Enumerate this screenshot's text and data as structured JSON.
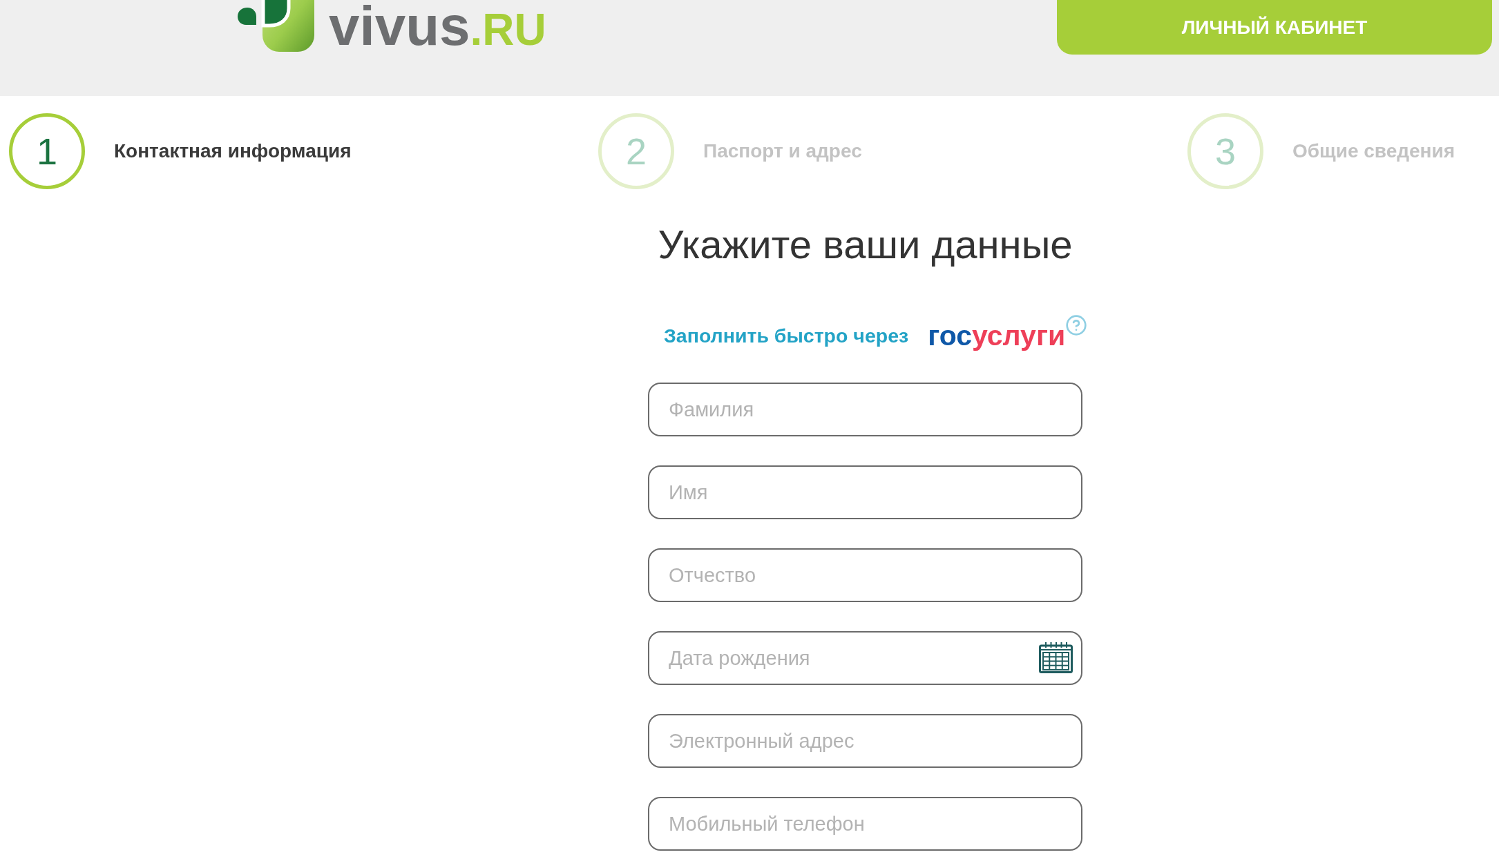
{
  "header": {
    "logo": {
      "name": "vivus",
      "domain": ".RU"
    },
    "account_button": "ЛИЧНЫЙ КАБИНЕТ"
  },
  "steps": [
    {
      "number": "1",
      "label": "Контактная информация",
      "selected": true
    },
    {
      "number": "2",
      "label": "Паспорт и адрес",
      "selected": false
    },
    {
      "number": "3",
      "label": "Общие сведения",
      "selected": false
    }
  ],
  "form": {
    "title": "Укажите ваши данные",
    "gosuslugi": {
      "text": "Заполнить быстро через",
      "logo_part_1": "гос",
      "logo_part_2": "услуги"
    },
    "fields": [
      {
        "kind": "text",
        "placeholder": "Фамилия"
      },
      {
        "kind": "text",
        "placeholder": "Имя"
      },
      {
        "kind": "text",
        "placeholder": "Отчество"
      },
      {
        "kind": "date",
        "placeholder": "Дата рождения"
      },
      {
        "kind": "text",
        "placeholder": "Электронный адрес"
      },
      {
        "kind": "text",
        "placeholder": "Мобильный телефон"
      }
    ]
  }
}
